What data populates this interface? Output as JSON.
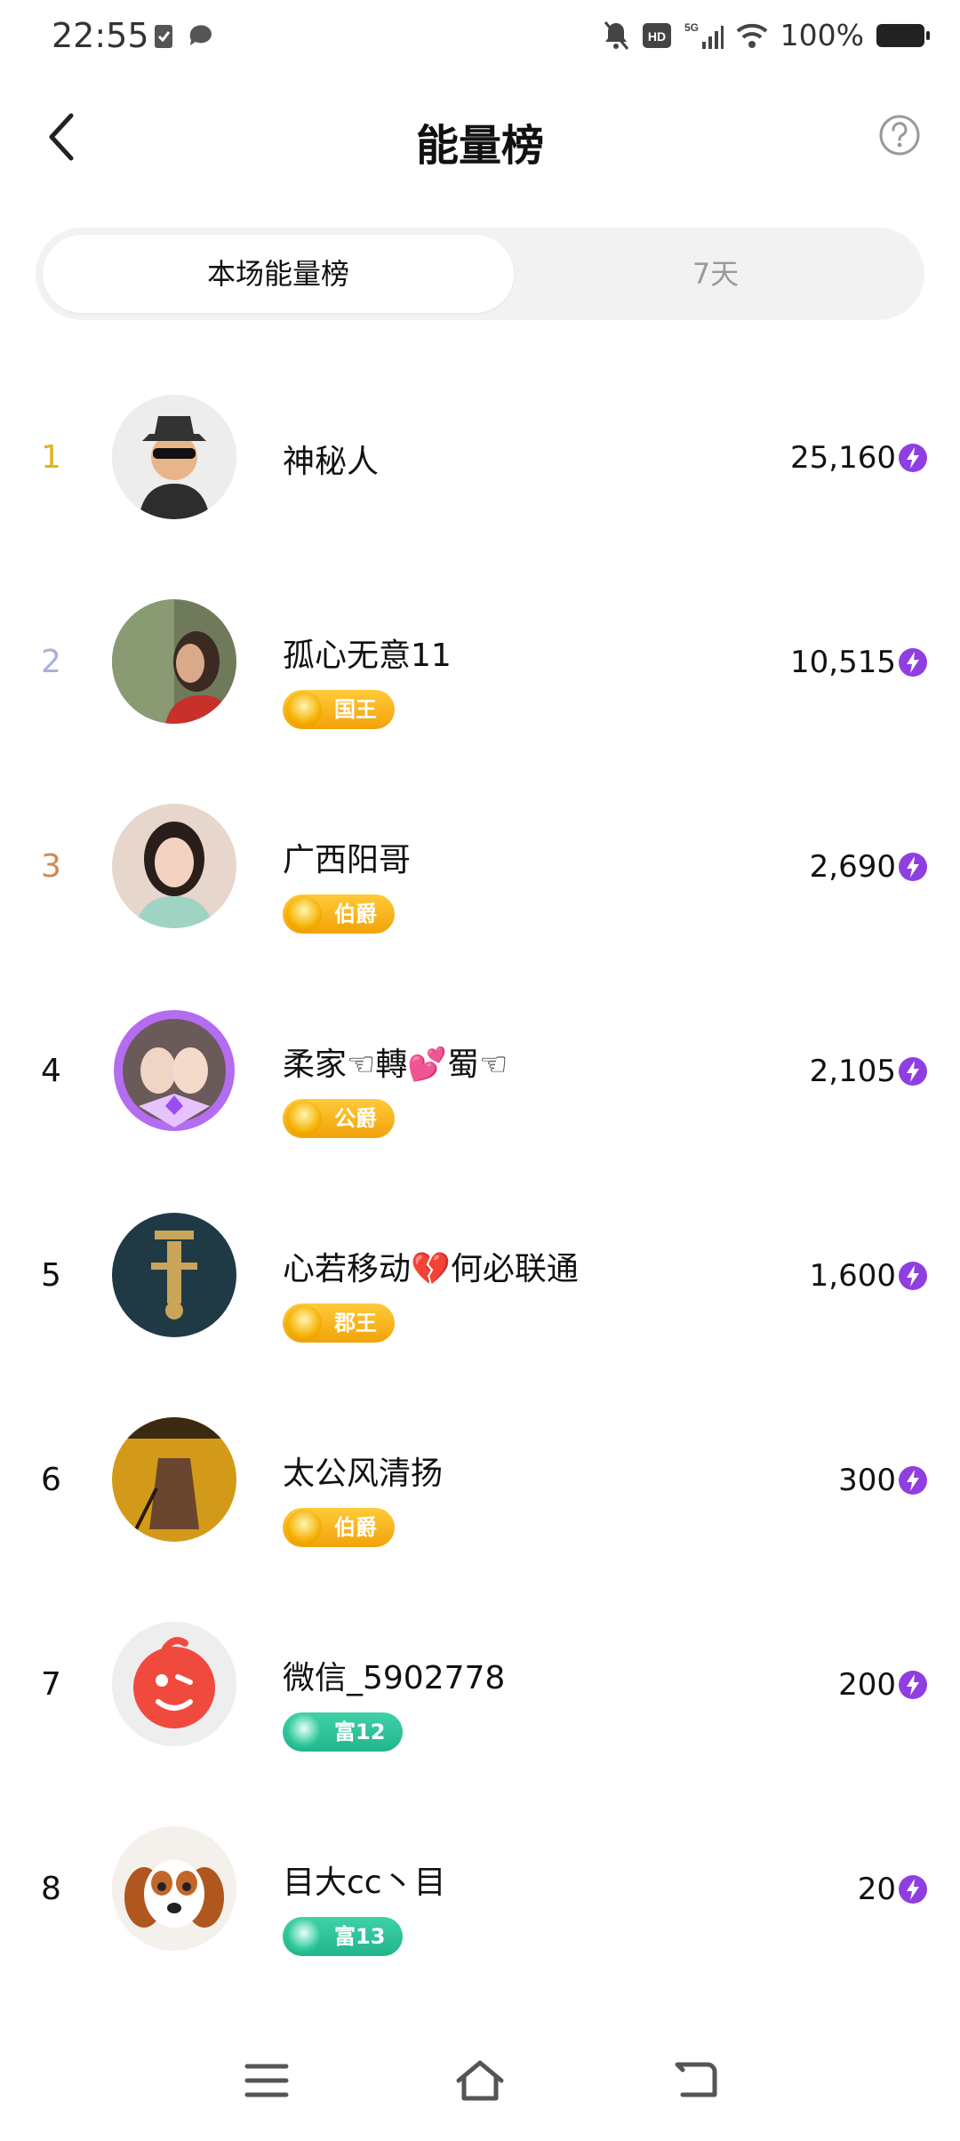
{
  "status_bar": {
    "time": "22:55",
    "battery": "100%"
  },
  "header": {
    "title": "能量榜"
  },
  "tabs": [
    {
      "label": "本场能量榜",
      "active": true
    },
    {
      "label": "7天",
      "active": false
    }
  ],
  "ranking": [
    {
      "rank": "1",
      "name": "神秘人",
      "badge": "",
      "score": "25,160"
    },
    {
      "rank": "2",
      "name": "孤心无意11",
      "badge": "国王",
      "score": "10,515"
    },
    {
      "rank": "3",
      "name": "广西阳哥",
      "badge": "伯爵",
      "score": "2,690"
    },
    {
      "rank": "4",
      "name": "柔家☜轉💕蜀☜",
      "badge": "公爵",
      "score": "2,105"
    },
    {
      "rank": "5",
      "name": "心若移动💔何必联通",
      "badge": "郡王",
      "score": "1,600"
    },
    {
      "rank": "6",
      "name": "太公风清扬",
      "badge": "伯爵",
      "score": "300"
    },
    {
      "rank": "7",
      "name": "微信_5902778",
      "badge": "富12",
      "score": "200"
    },
    {
      "rank": "8",
      "name": "目大cc丶目",
      "badge": "富13",
      "score": "20"
    }
  ],
  "colors": {
    "rank1": "#e4b320",
    "rank2": "#a9b0d8",
    "rank3": "#cd8a55",
    "energy": "#8f3fe0"
  }
}
